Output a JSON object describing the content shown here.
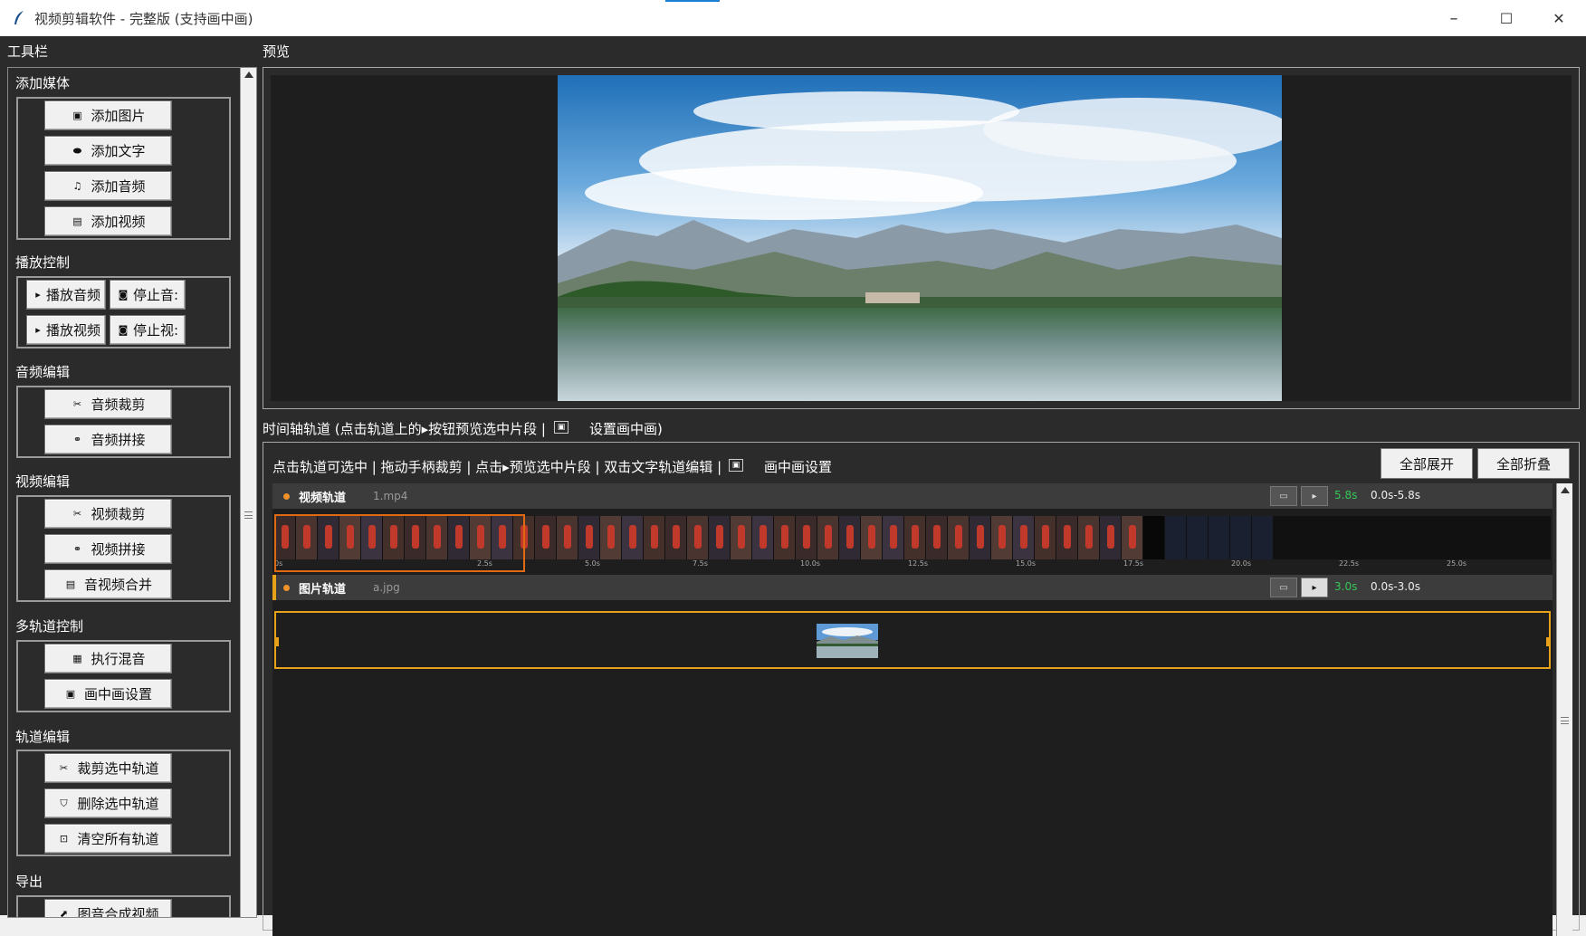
{
  "window": {
    "title": "视频剪辑软件 - 完整版 (支持画中画)",
    "minimize": "–",
    "maximize": "☐",
    "close": "✕"
  },
  "labels": {
    "toolbar": "工具栏",
    "preview": "预览",
    "timeline_title": "时间轴轨道 (点击轨道上的▸按钮预览选中片段 |",
    "timeline_pip": "设置画中画)"
  },
  "sidebar": {
    "groups": [
      {
        "title": "添加媒体",
        "buttons": [
          {
            "label": "添加图片",
            "icon": "image-icon"
          },
          {
            "label": "添加文字",
            "icon": "text-icon"
          },
          {
            "label": "添加音频",
            "icon": "music-icon"
          },
          {
            "label": "添加视频",
            "icon": "video-icon"
          }
        ]
      },
      {
        "title": "播放控制",
        "buttons": [
          {
            "label": "播放音频",
            "icon": "play-icon"
          },
          {
            "label": "停止音:",
            "icon": "stop-icon"
          },
          {
            "label": "播放视频",
            "icon": "play-icon"
          },
          {
            "label": "停止视:",
            "icon": "stop-icon"
          }
        ]
      },
      {
        "title": "音频编辑",
        "buttons": [
          {
            "label": "音频裁剪",
            "icon": "scissors-icon"
          },
          {
            "label": "音频拼接",
            "icon": "link-icon"
          }
        ]
      },
      {
        "title": "视频编辑",
        "buttons": [
          {
            "label": "视频裁剪",
            "icon": "scissors-icon"
          },
          {
            "label": "视频拼接",
            "icon": "link-icon"
          },
          {
            "label": "音视频合并",
            "icon": "video-icon"
          }
        ]
      },
      {
        "title": "多轨道控制",
        "buttons": [
          {
            "label": "执行混音",
            "icon": "mixer-icon"
          },
          {
            "label": "画中画设置",
            "icon": "pip-icon"
          }
        ]
      },
      {
        "title": "轨道编辑",
        "buttons": [
          {
            "label": "裁剪选中轨道",
            "icon": "scissors-icon"
          },
          {
            "label": "删除选中轨道",
            "icon": "trash-icon"
          },
          {
            "label": "清空所有轨道",
            "icon": "clear-icon"
          }
        ]
      },
      {
        "title": "导出",
        "buttons": [
          {
            "label": "图音合成视频",
            "icon": "export-icon"
          }
        ]
      }
    ]
  },
  "timeline": {
    "hint": "点击轨道可选中 | 拖动手柄裁剪 | 点击▸预览选中片段 | 双击文字轨道编辑 |",
    "hint_pip": "画中画设置",
    "expand_all": "全部展开",
    "collapse_all": "全部折叠",
    "tracks": [
      {
        "name": "视频轨道",
        "file": "1.mp4",
        "duration": "5.8s",
        "range": "0.0s-5.8s"
      },
      {
        "name": "图片轨道",
        "file": "a.jpg",
        "duration": "3.0s",
        "range": "0.0s-3.0s"
      }
    ],
    "ticks": [
      "0s",
      "2.5s",
      "5.0s",
      "7.5s",
      "10.0s",
      "12.5s",
      "15.0s",
      "17.5s",
      "20.0s",
      "22.5s",
      "25.0s"
    ]
  },
  "colors": {
    "accent_orange": "#e06a12",
    "image_track": "#e8a21a",
    "duration_green": "#34c757"
  }
}
